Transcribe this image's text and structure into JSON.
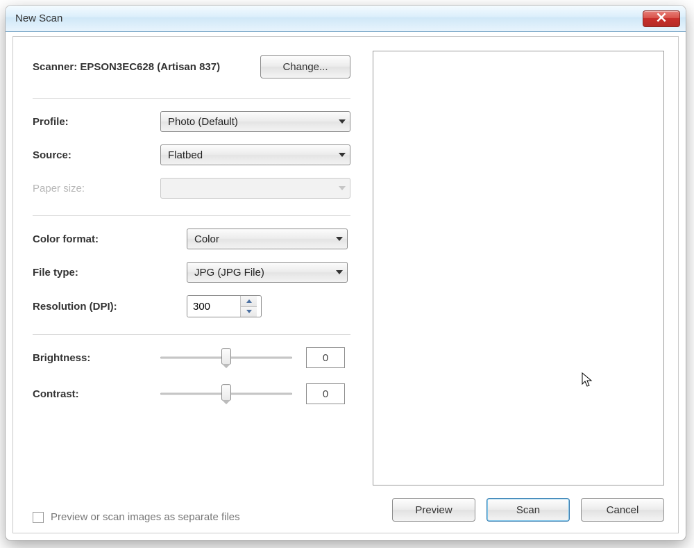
{
  "window": {
    "title": "New Scan"
  },
  "scanner": {
    "label_prefix": "Scanner: ",
    "name": "EPSON3EC628 (Artisan 837)",
    "change_button": "Change..."
  },
  "fields": {
    "profile": {
      "label": "Profile:",
      "value": "Photo (Default)"
    },
    "source": {
      "label": "Source:",
      "value": "Flatbed"
    },
    "paper": {
      "label": "Paper size:",
      "value": ""
    },
    "colorfmt": {
      "label": "Color format:",
      "value": "Color"
    },
    "filetype": {
      "label": "File type:",
      "value": "JPG (JPG File)"
    },
    "resolution": {
      "label": "Resolution (DPI):",
      "value": "300"
    },
    "brightness": {
      "label": "Brightness:",
      "value": "0"
    },
    "contrast": {
      "label": "Contrast:",
      "value": "0"
    }
  },
  "separate_checkbox": {
    "label": "Preview or scan images as separate files",
    "checked": false
  },
  "buttons": {
    "preview": "Preview",
    "scan": "Scan",
    "cancel": "Cancel"
  }
}
